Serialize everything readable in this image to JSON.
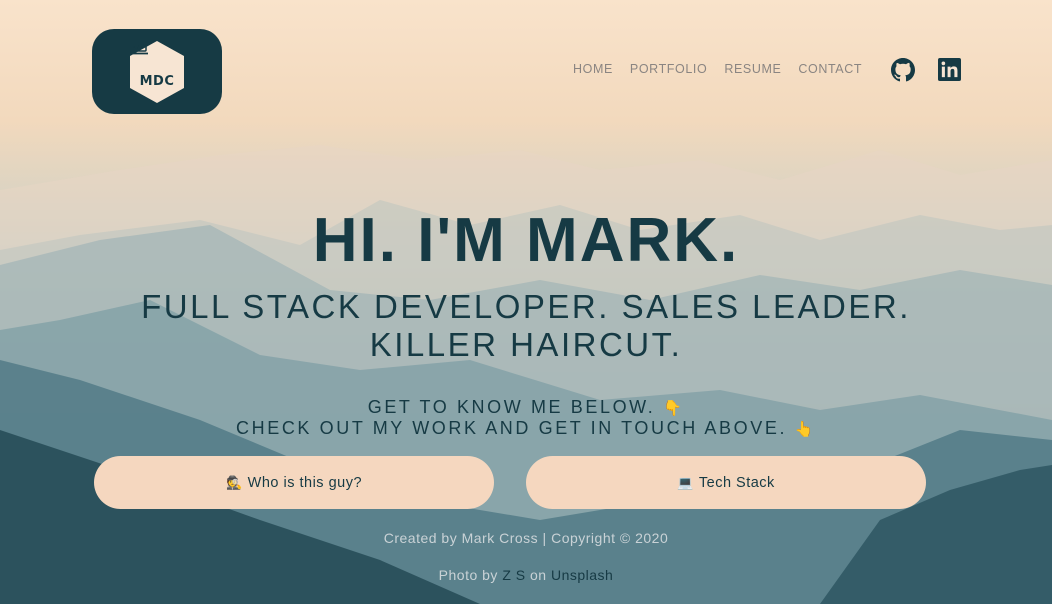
{
  "logo": {
    "text": "MDC",
    "icon": "code-laptop-icon"
  },
  "nav": {
    "items": [
      "HOME",
      "PORTFOLIO",
      "RESUME",
      "CONTACT"
    ]
  },
  "social": {
    "github_icon": "github-icon",
    "linkedin_icon": "linkedin-icon"
  },
  "hero": {
    "title": "HI. I'M MARK.",
    "subtitle_line1": "FULL STACK DEVELOPER. SALES LEADER.",
    "subtitle_line2": "KILLER HAIRCUT.",
    "tagline_line1": "GET TO KNOW ME BELOW.",
    "tagline_line2": "CHECK OUT MY WORK AND GET IN TOUCH ABOVE.",
    "tagline_icon1": "👇",
    "tagline_icon2": "👆"
  },
  "buttons": {
    "who": {
      "label": "Who is this guy?",
      "icon": "🕵"
    },
    "tech": {
      "label": "Tech Stack",
      "icon": "💻"
    }
  },
  "footer": {
    "copyright": "Created by Mark Cross | Copyright © 2020",
    "photo_prefix": "Photo by",
    "photo_author": "Z S",
    "photo_mid": "on",
    "photo_site": "Unsplash"
  },
  "colors": {
    "primary": "#163a44",
    "button_bg": "#f5d7bf",
    "nav_text": "#8a8582"
  }
}
